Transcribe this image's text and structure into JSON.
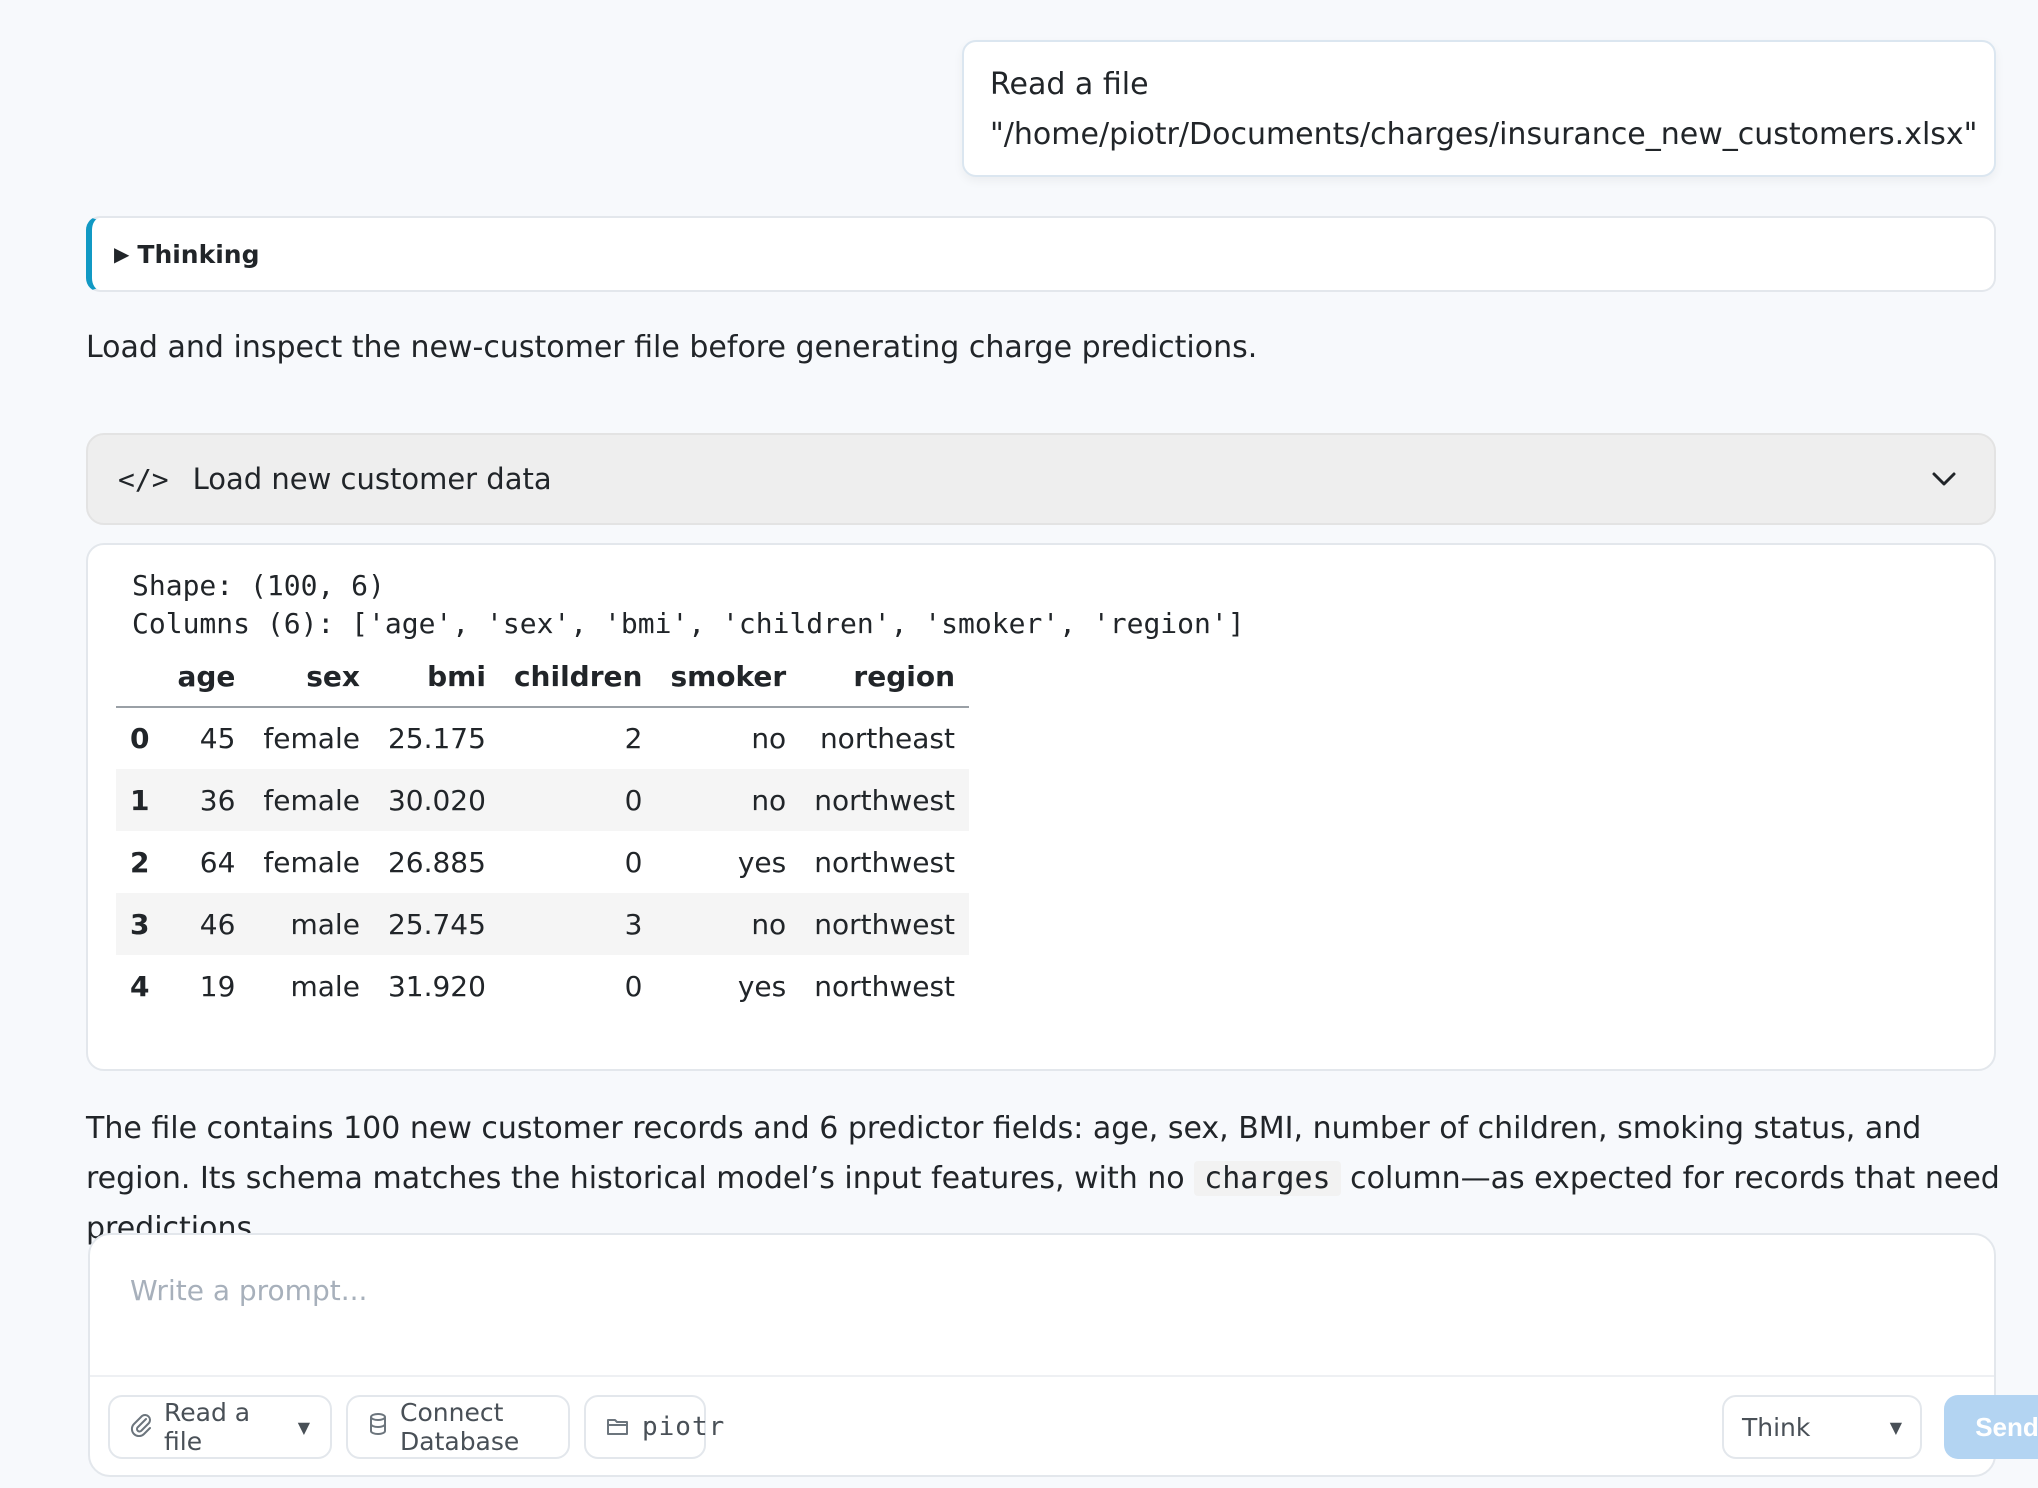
{
  "user_message": {
    "line1": "Read a file",
    "line2": "\"/home/piotr/Documents/charges/insurance_new_customers.xlsx\""
  },
  "thinking": {
    "label": "Thinking"
  },
  "assistant_intro": "Load and inspect the new-customer file before generating charge predictions.",
  "code_block": {
    "icon": "code-icon",
    "title": "Load new customer data",
    "toggle_icon": "chevron-down-icon"
  },
  "output": {
    "shape_line": "Shape: (100, 6)",
    "columns_line": "Columns (6): ['age', 'sex', 'bmi', 'children', 'smoker', 'region']",
    "table": {
      "headers": [
        "",
        "age",
        "sex",
        "bmi",
        "children",
        "smoker",
        "region"
      ],
      "rows": [
        [
          "0",
          "45",
          "female",
          "25.175",
          "2",
          "no",
          "northeast"
        ],
        [
          "1",
          "36",
          "female",
          "30.020",
          "0",
          "no",
          "northwest"
        ],
        [
          "2",
          "64",
          "female",
          "26.885",
          "0",
          "yes",
          "northwest"
        ],
        [
          "3",
          "46",
          "male",
          "25.745",
          "3",
          "no",
          "northwest"
        ],
        [
          "4",
          "19",
          "male",
          "31.920",
          "0",
          "yes",
          "northwest"
        ]
      ]
    }
  },
  "summary": {
    "part1": "The file contains 100 new customer records and 6 predictor fields: age, sex, BMI, number of children, smoking status, and region. Its schema matches the historical model’s input features, with no ",
    "code": "charges",
    "part2": " column—as expected for records that need predictions."
  },
  "composer": {
    "placeholder": "Write a prompt...",
    "read_file_label": "Read a file",
    "connect_db_label": "Connect Database",
    "folder_label": "piotr",
    "mode_value": "Think",
    "send_label": "Send"
  },
  "colors": {
    "accent": "#1199c4",
    "send_disabled": "#b3d4f2",
    "page_bg": "#f7f9fc"
  }
}
